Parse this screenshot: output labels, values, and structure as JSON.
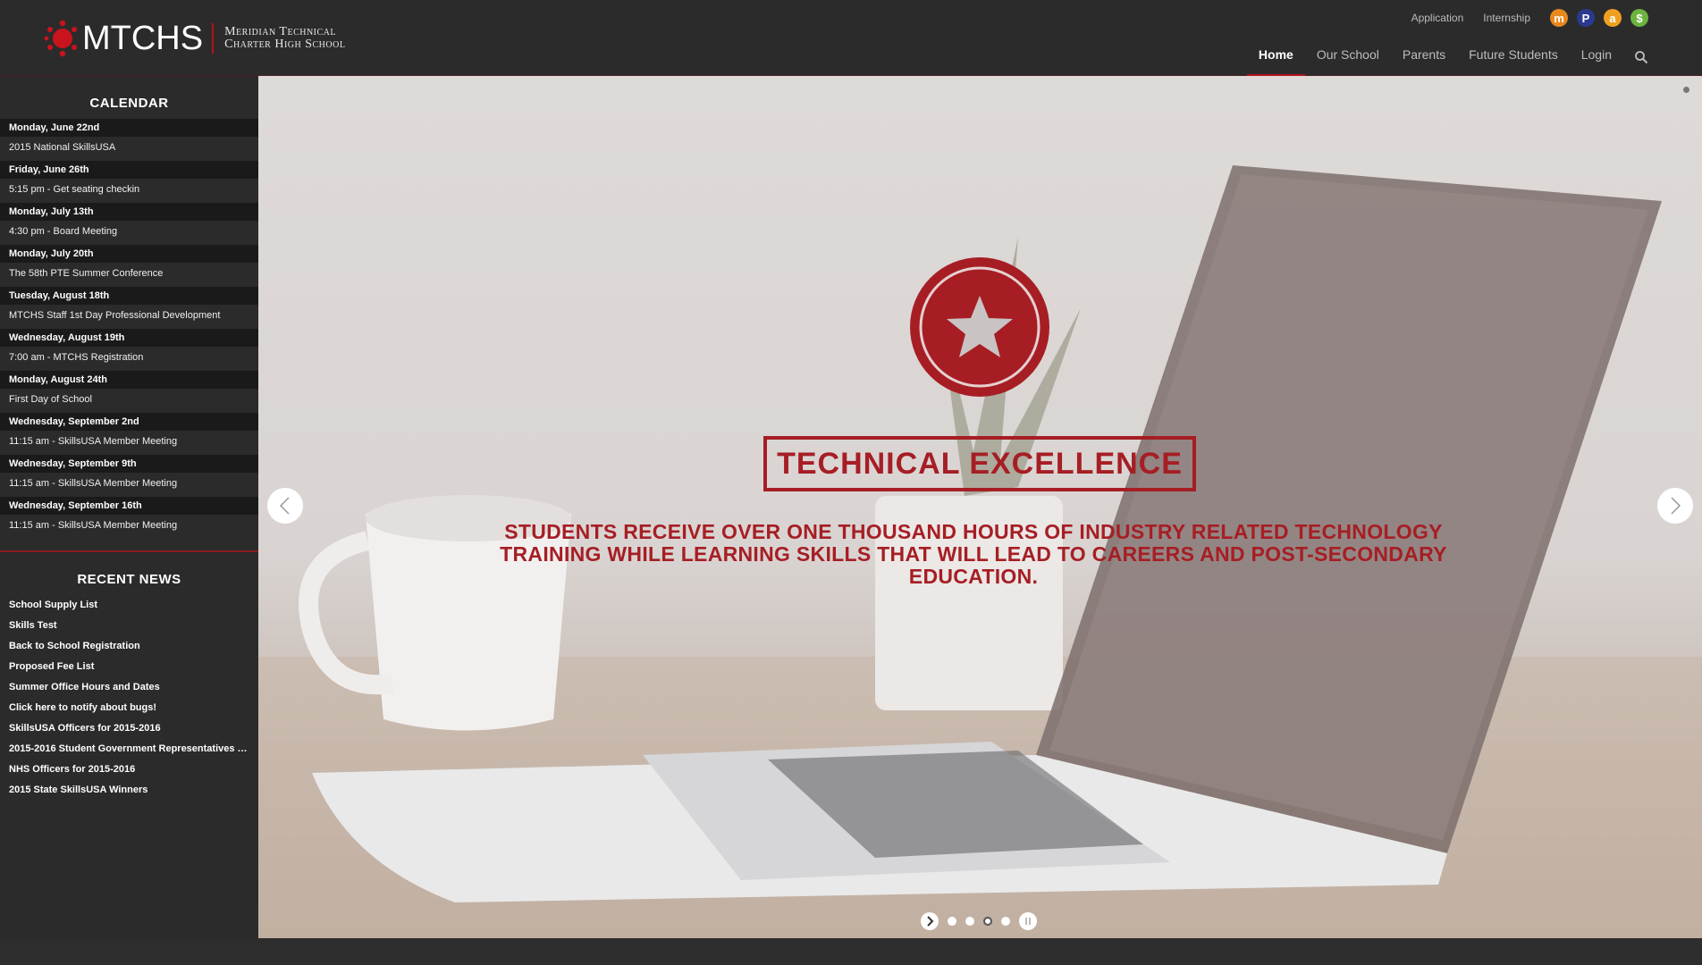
{
  "brand": {
    "abbr": "MTCHS",
    "name_line1": "Meridian Technical",
    "name_line2": "Charter High School",
    "accent": "#b5121b"
  },
  "utility": {
    "links": [
      "Application",
      "Internship"
    ],
    "icons": [
      {
        "name": "m-icon",
        "glyph": "m",
        "color": "#e8881d"
      },
      {
        "name": "p-icon",
        "glyph": "P",
        "color": "#2b3a8f"
      },
      {
        "name": "a-icon",
        "glyph": "a",
        "color": "#f0a020"
      },
      {
        "name": "dollar-icon",
        "glyph": "$",
        "color": "#6db33f"
      }
    ]
  },
  "nav": {
    "items": [
      "Home",
      "Our School",
      "Parents",
      "Future Students",
      "Login"
    ],
    "active": "Home"
  },
  "calendar": {
    "title": "CALENDAR",
    "events": [
      {
        "date": "Monday, June 22nd",
        "event": "2015 National SkillsUSA"
      },
      {
        "date": "Friday, June 26th",
        "event": "5:15 pm - Get seating checkin"
      },
      {
        "date": "Monday, July 13th",
        "event": "4:30 pm - Board Meeting"
      },
      {
        "date": "Monday, July 20th",
        "event": "The 58th PTE Summer Conference"
      },
      {
        "date": "Tuesday, August 18th",
        "event": "MTCHS Staff 1st Day Professional Development"
      },
      {
        "date": "Wednesday, August 19th",
        "event": "7:00 am - MTCHS Registration"
      },
      {
        "date": "Monday, August 24th",
        "event": "First Day of School"
      },
      {
        "date": "Wednesday, September 2nd",
        "event": "11:15 am - SkillsUSA Member Meeting"
      },
      {
        "date": "Wednesday, September 9th",
        "event": "11:15 am - SkillsUSA Member Meeting"
      },
      {
        "date": "Wednesday, September 16th",
        "event": "11:15 am - SkillsUSA Member Meeting"
      }
    ]
  },
  "news": {
    "title": "RECENT NEWS",
    "items": [
      "School Supply List",
      "Skills Test",
      "Back to School Registration",
      "Proposed Fee List",
      "Summer Office Hours and Dates",
      "Click here to notify about bugs!",
      "SkillsUSA Officers for 2015-2016",
      "2015-2016 Student Government Representatives an...",
      "NHS Officers for 2015-2016",
      "2015 State SkillsUSA Winners"
    ]
  },
  "hero": {
    "headline": "TECHNICAL EXCELLENCE",
    "subline": "STUDENTS RECEIVE OVER ONE THOUSAND HOURS OF INDUSTRY RELATED TECHNOLOGY TRAINING WHILE LEARNING SKILLS THAT WILL LEAD TO CAREERS AND POST-SECONDARY EDUCATION.",
    "accent": "#a61e24",
    "slide_count": 4,
    "current_slide": 3
  }
}
